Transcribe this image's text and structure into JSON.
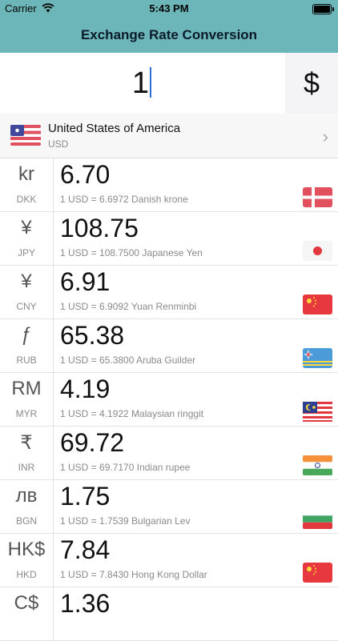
{
  "status": {
    "carrier": "Carrier",
    "time": "5:43 PM"
  },
  "nav": {
    "title": "Exchange Rate Conversion"
  },
  "input": {
    "amount": "1",
    "currency_button": "$"
  },
  "base": {
    "country": "United States of America",
    "code": "USD",
    "flag_icon": "us-flag-icon"
  },
  "rates": [
    {
      "symbol": "kr",
      "code": "DKK",
      "value": "6.70",
      "rate": "1 USD = 6.6972 Danish krone",
      "flag_icon": "denmark-flag-icon"
    },
    {
      "symbol": "¥",
      "code": "JPY",
      "value": "108.75",
      "rate": "1 USD = 108.7500 Japanese Yen",
      "flag_icon": "japan-flag-icon"
    },
    {
      "symbol": "¥",
      "code": "CNY",
      "value": "6.91",
      "rate": "1 USD = 6.9092 Yuan Renminbi",
      "flag_icon": "china-flag-icon"
    },
    {
      "symbol": "ƒ",
      "code": "RUB",
      "value": "65.38",
      "rate": "1 USD = 65.3800 Aruba Guilder",
      "flag_icon": "aruba-flag-icon"
    },
    {
      "symbol": "RM",
      "code": "MYR",
      "value": "4.19",
      "rate": "1 USD = 4.1922 Malaysian ringgit",
      "flag_icon": "malaysia-flag-icon"
    },
    {
      "symbol": "₹",
      "code": "INR",
      "value": "69.72",
      "rate": "1 USD = 69.7170 Indian rupee",
      "flag_icon": "india-flag-icon"
    },
    {
      "symbol": "лв",
      "code": "BGN",
      "value": "1.75",
      "rate": "1 USD = 1.7539 Bulgarian Lev",
      "flag_icon": "bulgaria-flag-icon"
    },
    {
      "symbol": "HK$",
      "code": "HKD",
      "value": "7.84",
      "rate": "1 USD = 7.8430 Hong Kong Dollar",
      "flag_icon": "china-flag-icon"
    },
    {
      "symbol": "C$",
      "code": "",
      "value": "1.36",
      "rate": "",
      "flag_icon": ""
    }
  ]
}
